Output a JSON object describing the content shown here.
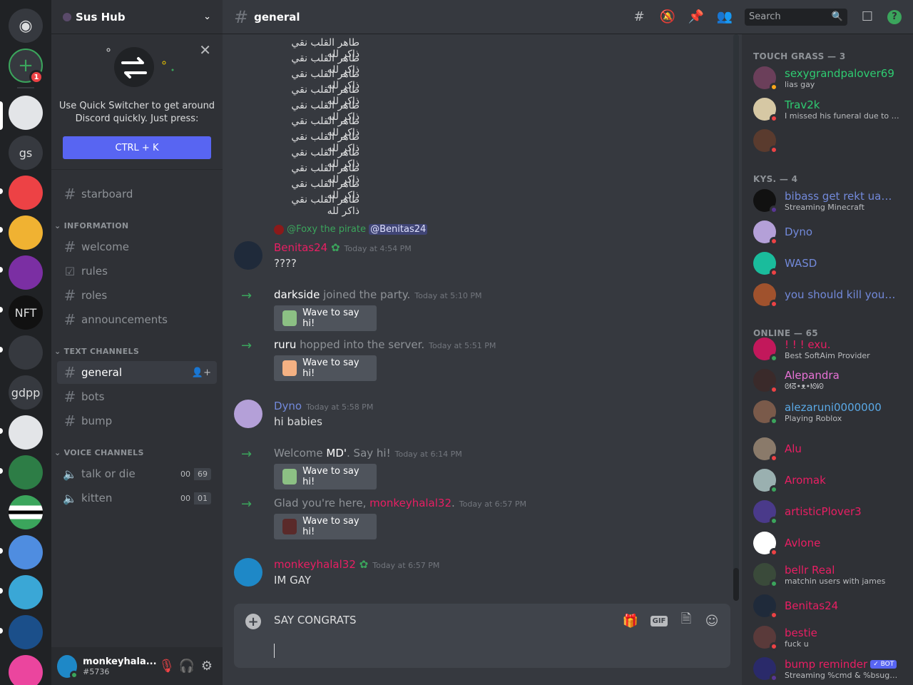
{
  "server": {
    "name": "Sus Hub",
    "rail": [
      {
        "label": "Direct Messages",
        "icon": "discord-logo-icon",
        "color": "#36393f"
      },
      {
        "label": "Add a Server",
        "icon": "add-server-icon",
        "color": "#36393f",
        "badge": "1"
      },
      {
        "label": "",
        "color": "#e3e5e8"
      },
      {
        "label": "gs",
        "color": "#36393f"
      },
      {
        "label": "",
        "color": "#ed4245"
      },
      {
        "label": "",
        "color": "#f0b232"
      },
      {
        "label": "",
        "color": "#7b2fa3"
      },
      {
        "label": "NFT",
        "color": "#111111"
      },
      {
        "label": "",
        "color": "#36393f"
      },
      {
        "label": "gdpp",
        "color": "#36393f"
      },
      {
        "label": "",
        "color": "#e3e5e8"
      },
      {
        "label": "",
        "color": "#2d7d46"
      },
      {
        "label": "",
        "color": "#000000"
      },
      {
        "label": "",
        "color": "#4f8de0"
      },
      {
        "label": "",
        "color": "#3aa7d6"
      },
      {
        "label": "",
        "color": "#1b4f8a"
      },
      {
        "label": "",
        "color": "#eb459e"
      }
    ]
  },
  "quick_switcher": {
    "text": "Use Quick Switcher to get around Discord quickly. Just press:",
    "button": "CTRL + K"
  },
  "channels": {
    "starboard": "starboard",
    "cat_information": "INFORMATION",
    "welcome": "welcome",
    "rules": "rules",
    "roles": "roles",
    "announcements": "announcements",
    "cat_text": "TEXT CHANNELS",
    "general": "general",
    "bots": "bots",
    "bump": "bump",
    "cat_voice": "VOICE CHANNELS",
    "voice1": "talk or die",
    "voice1_a": "00",
    "voice1_b": "69",
    "voice2": "kitten",
    "voice2_a": "00",
    "voice2_b": "01"
  },
  "user": {
    "name": "monkeyhala...",
    "tag": "#5736"
  },
  "topbar": {
    "channel": "general",
    "search_placeholder": "Search"
  },
  "arabic_line": "طاهر القلب نقي ذاكر لله",
  "messages": {
    "reply_to": "@Foxy the pirate",
    "reply_mention": "@Benitas24",
    "m1_name": "Benitas24",
    "m1_ts": "Today at 4:54 PM",
    "m1_text": "????",
    "j1_user": "darkside",
    "j1_text": " joined the party.",
    "j1_ts": "Today at 5:10 PM",
    "j2_user": "ruru",
    "j2_text": " hopped into the server.",
    "j2_ts": "Today at 5:51 PM",
    "m2_name": "Dyno",
    "m2_ts": "Today at 5:58 PM",
    "m2_text": "hi babies",
    "j3_pre": "Welcome ",
    "j3_user": "MD'",
    "j3_post": ". Say hi!",
    "j3_ts": "Today at 6:14 PM",
    "j4_pre": "Glad you're here, ",
    "j4_user": "monkeyhalal32",
    "j4_post": ".",
    "j4_ts": "Today at 6:57 PM",
    "m3_name": "monkeyhalal32",
    "m3_ts": "Today at 6:57 PM",
    "m3_text": "IM GAY",
    "wave": "Wave to say hi!"
  },
  "composer": {
    "value": "SAY CONGRATS"
  },
  "members": {
    "g1": "TOUCH GRASS — 3",
    "g2": "KYS. — 4",
    "g3": "ONLINE — 65",
    "list": [
      {
        "name": "sexygrandpalover69",
        "status": "lias gay",
        "color": "#2ecc71",
        "av": "#6b3f5a",
        "dot": "#faa61a"
      },
      {
        "name": "Trav2k",
        "status": "I missed his funeral due to covi...",
        "color": "#2ecc71",
        "av": "#d6c8a4",
        "dot": "#ed4245"
      },
      {
        "name": "",
        "status": "",
        "color": "#2ecc71",
        "av": "#5a3b2e",
        "dot": "#ed4245"
      },
      {
        "name": "bibass get rekt uamee...",
        "status": "Streaming Minecraft",
        "color": "#7289da",
        "av": "#111111",
        "dot": "#593695"
      },
      {
        "name": "Dyno",
        "status": "",
        "color": "#7289da",
        "av": "#b4a0d8",
        "dot": "#ed4245"
      },
      {
        "name": "WASD",
        "status": "",
        "color": "#7289da",
        "av": "#1abc9c",
        "dot": "#ed4245"
      },
      {
        "name": "you should kill yoursel...",
        "status": "",
        "color": "#7289da",
        "av": "#a0522d",
        "dot": "#ed4245"
      },
      {
        "name": "! ! ! exu.",
        "status": "Best SoftAim Provider",
        "color": "#e91e63",
        "av": "#c2185b",
        "dot": "#3ba55c"
      },
      {
        "name": "Alepandra",
        "status": "ᘛᘔ•ᴥ•ᘚᘗ",
        "color": "#e872d6",
        "av": "#3a2a2a",
        "dot": "#ed4245"
      },
      {
        "name": "alezaruni0000000",
        "status": "Playing Roblox",
        "color": "#5aa9e6",
        "av": "#7a5a4a",
        "dot": "#3ba55c"
      },
      {
        "name": "Alu",
        "status": "",
        "color": "#e91e63",
        "av": "#8a7a6a",
        "dot": "#ed4245"
      },
      {
        "name": "Aromak",
        "status": "",
        "color": "#e91e63",
        "av": "#9ab0b0",
        "dot": "#3ba55c"
      },
      {
        "name": "artisticPlover3",
        "status": "",
        "color": "#e91e63",
        "av": "#4a3a8a",
        "dot": "#3ba55c"
      },
      {
        "name": "Avlone",
        "status": "",
        "color": "#e91e63",
        "av": "#ffffff",
        "dot": "#ed4245"
      },
      {
        "name": "bellr Real",
        "status": "matchin users with james",
        "color": "#e91e63",
        "av": "#3a4a3a",
        "dot": "#3ba55c"
      },
      {
        "name": "Benitas24",
        "status": "",
        "color": "#e91e63",
        "av": "#1f2a3a",
        "dot": "#ed4245"
      },
      {
        "name": "bestie",
        "status": "fuck u",
        "color": "#e91e63",
        "av": "#5a3a3a",
        "dot": "#ed4245"
      },
      {
        "name": "bump reminder",
        "status": "Streaming %cmd & %bsugges...",
        "color": "#e91e63",
        "av": "#2a2a6a",
        "dot": "#593695",
        "bot": "✓ BOT"
      }
    ]
  }
}
